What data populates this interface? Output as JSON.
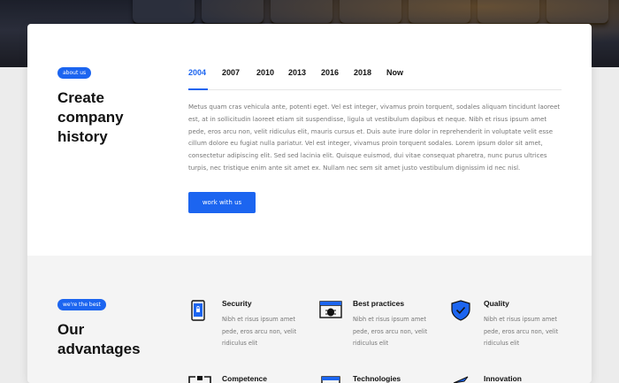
{
  "history": {
    "badge": "about us",
    "title": "Create company history",
    "tabs": [
      "2004",
      "2007",
      "2010",
      "2013",
      "2016",
      "2018",
      "Now"
    ],
    "active_tab": "2004",
    "paragraph": "Metus quam cras vehicula ante, potenti eget. Vel est integer, vivamus proin torquent, sodales aliquam tincidunt laoreet est, at in sollicitudin laoreet etiam sit suspendisse, ligula ut vestibulum dapibus et neque. Nibh et risus ipsum amet pede, eros arcu non, velit ridiculus elit, mauris cursus et. Duis aute irure dolor in reprehenderit in voluptate velit esse cillum dolore eu fugiat nulla pariatur. Vel est integer, vivamus proin torquent sodales. Lorem ipsum dolor sit amet, consectetur adipiscing elit. Sed sed lacinia elit. Quisque euismod, dui vitae consequat pharetra, nunc purus ultrices turpis, nec tristique enim ante sit amet ex. Nullam nec sem sit amet justo vestibulum dignissim id nec nisl.",
    "button_label": "work with us"
  },
  "advantages": {
    "badge": "we're the best",
    "title": "Our advantages",
    "items": [
      {
        "title": "Security",
        "desc": "Nibh et risus ipsum amet pede, eros arcu non, velit ridiculus elit",
        "icon": "security-phone-lock-icon"
      },
      {
        "title": "Best practices",
        "desc": "Nibh et risus ipsum amet pede, eros arcu non, velit ridiculus elit",
        "icon": "bug-window-icon"
      },
      {
        "title": "Quality",
        "desc": "Nibh et risus ipsum amet pede, eros arcu non, velit ridiculus elit",
        "icon": "shield-check-icon"
      },
      {
        "title": "Competence",
        "desc": "",
        "icon": "competence-icon"
      },
      {
        "title": "Technologies",
        "desc": "",
        "icon": "technologies-icon"
      },
      {
        "title": "Innovation",
        "desc": "",
        "icon": "innovation-icon"
      }
    ]
  },
  "colors": {
    "accent": "#1c65f0",
    "text": "#111111",
    "muted": "#777777",
    "section_bg": "#f4f4f4"
  }
}
